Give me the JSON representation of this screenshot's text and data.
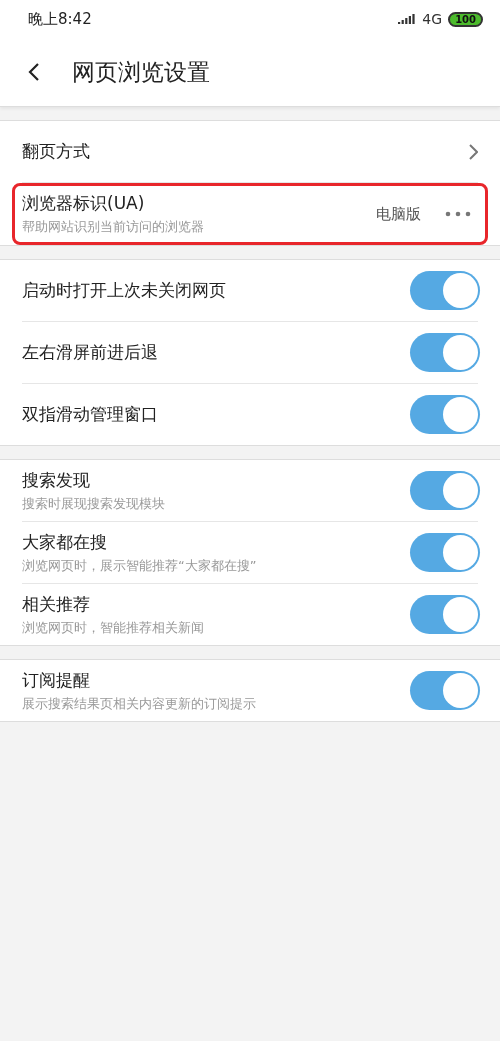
{
  "status_bar": {
    "time": "晚上8:42",
    "network": "4G",
    "battery": "100"
  },
  "header": {
    "title": "网页浏览设置"
  },
  "sections": [
    {
      "items": [
        {
          "kind": "link",
          "label": "翻页方式",
          "highlighted": false
        },
        {
          "kind": "value",
          "label": "浏览器标识(UA)",
          "description": "帮助网站识别当前访问的浏览器",
          "value": "电脑版",
          "highlighted": true
        }
      ]
    },
    {
      "items": [
        {
          "kind": "toggle",
          "label": "启动时打开上次未关闭网页",
          "on": true
        },
        {
          "kind": "toggle",
          "label": "左右滑屏前进后退",
          "on": true
        },
        {
          "kind": "toggle",
          "label": "双指滑动管理窗口",
          "on": true
        }
      ]
    },
    {
      "items": [
        {
          "kind": "toggle",
          "label": "搜索发现",
          "description": "搜索时展现搜索发现模块",
          "on": true
        },
        {
          "kind": "toggle",
          "label": "大家都在搜",
          "description": "浏览网页时，展示智能推荐“大家都在搜”",
          "on": true
        },
        {
          "kind": "toggle",
          "label": "相关推荐",
          "description": "浏览网页时，智能推荐相关新闻",
          "on": true
        }
      ]
    },
    {
      "items": [
        {
          "kind": "toggle",
          "label": "订阅提醒",
          "description": "展示搜索结果页相关内容更新的订阅提示",
          "on": true
        }
      ]
    }
  ]
}
